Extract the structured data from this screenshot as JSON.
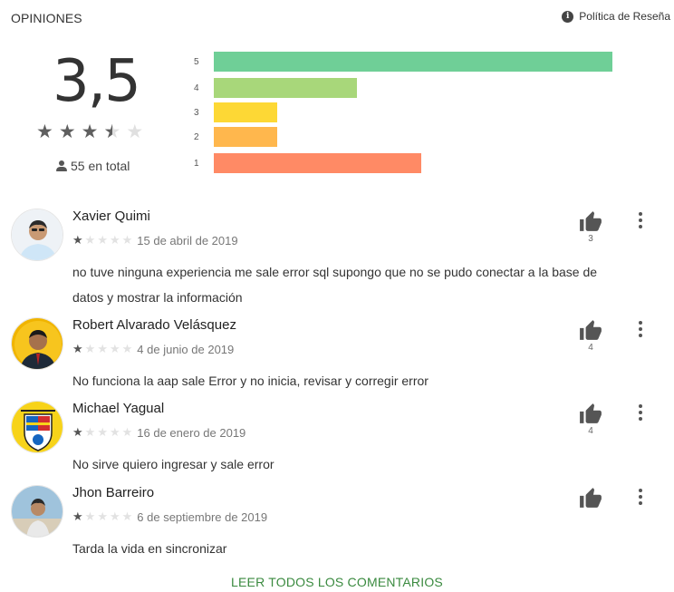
{
  "header": {
    "title": "OPINIONES",
    "policy_label": "Política de Reseña",
    "info_glyph": "i"
  },
  "summary": {
    "rating": "3,5",
    "rating_value": 3.5,
    "max_stars": 5,
    "total_label": "55 en total"
  },
  "histogram": [
    {
      "label": "5",
      "fraction": 1.0,
      "color": "#6fcf97"
    },
    {
      "label": "4",
      "fraction": 0.36,
      "color": "#a8d77a"
    },
    {
      "label": "3",
      "fraction": 0.16,
      "color": "#fdd835"
    },
    {
      "label": "2",
      "fraction": 0.16,
      "color": "#ffb74d"
    },
    {
      "label": "1",
      "fraction": 0.52,
      "color": "#ff8a65"
    }
  ],
  "reviews": [
    {
      "name": "Xavier Quimi",
      "stars": 1,
      "date": "15 de abril de 2019",
      "text": "no tuve ninguna experiencia me sale error sql supongo que no se pudo conectar a la base de datos y mostrar la información",
      "likes": "3"
    },
    {
      "name": "Robert Alvarado Velásquez",
      "stars": 1,
      "date": "4 de junio de 2019",
      "text": "No funciona la aap sale Error y no inicia, revisar y corregir error",
      "likes": "4"
    },
    {
      "name": "Michael Yagual",
      "stars": 1,
      "date": "16 de enero de 2019",
      "text": "No sirve quiero ingresar y sale error",
      "likes": "4"
    },
    {
      "name": "Jhon Barreiro",
      "stars": 1,
      "date": "6 de septiembre de 2019",
      "text": "Tarda la vida en sincronizar",
      "likes": ""
    }
  ],
  "footer": {
    "read_all_label": "LEER TODOS LOS COMENTARIOS"
  },
  "colors": {
    "accent": "#3a8a3f",
    "star_on": "#5f5f5f",
    "star_off": "#e0e0e0"
  },
  "icons": {
    "info": "info-icon",
    "person": "person-icon",
    "thumb": "thumb-up-icon",
    "menu": "more-vert-icon"
  }
}
